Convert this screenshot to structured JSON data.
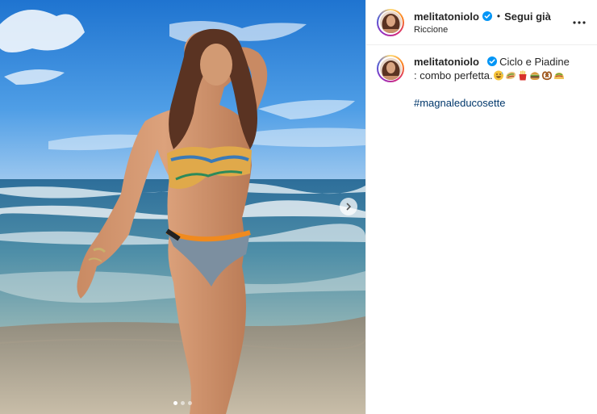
{
  "post": {
    "author": {
      "username": "melitatoniolo",
      "verified": true,
      "follow_label": "Segui già",
      "separator": "•",
      "location": "Riccione"
    },
    "more_icon": "more-horizontal-icon",
    "caption": {
      "username": "melitatoniolo",
      "text": "Ciclo e Piadine : combo perfetta.",
      "emojis": [
        "grinning-sweat-emoji",
        "burrito-emoji",
        "fries-emoji",
        "burger-emoji",
        "pretzel-emoji",
        "taco-emoji"
      ],
      "hashtag": "#magnaleducosette"
    },
    "carousel": {
      "current_index": 1,
      "total": 3,
      "next_icon": "chevron-right-icon"
    },
    "colors": {
      "link": "#00376b",
      "verified": "#0095f6",
      "border": "#efefef"
    }
  }
}
